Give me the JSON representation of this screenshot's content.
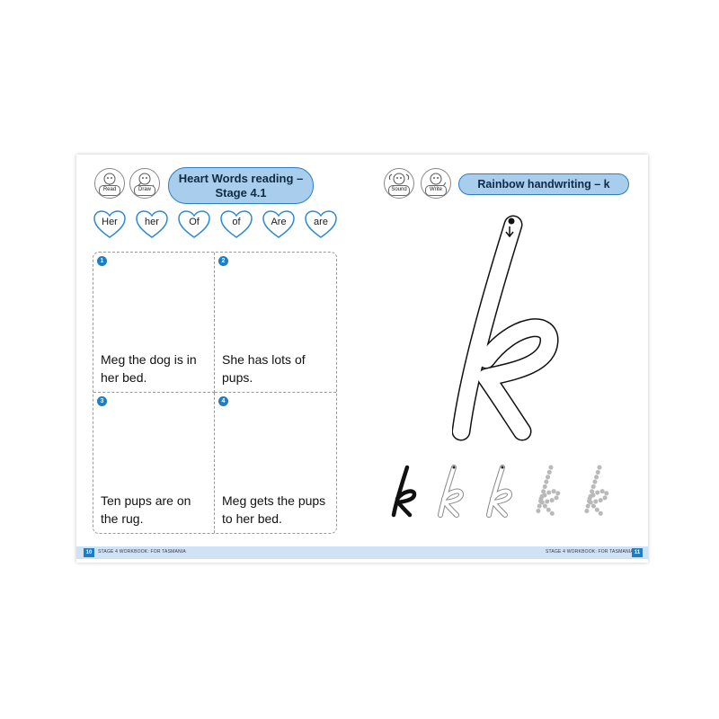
{
  "left_page": {
    "badges": [
      {
        "label": "Read"
      },
      {
        "label": "Draw"
      }
    ],
    "title_line1": "Heart Words reading –",
    "title_line2": "Stage 4.1",
    "heart_words": [
      "Her",
      "her",
      "Of",
      "of",
      "Are",
      "are"
    ],
    "panels": [
      {
        "number": "1",
        "text": "Meg the dog is in her bed."
      },
      {
        "number": "2",
        "text": "She has lots of pups."
      },
      {
        "number": "3",
        "text": "Ten pups are on the rug."
      },
      {
        "number": "4",
        "text": "Meg gets the pups to her bed."
      }
    ],
    "footer": {
      "page_number": "10",
      "text": "STAGE 4 WORKBOOK: FOR TASMANIA"
    }
  },
  "right_page": {
    "badges": [
      {
        "label": "Sound"
      },
      {
        "label": "Write"
      }
    ],
    "title": "Rainbow handwriting – k",
    "practice_letters": [
      {
        "style": "solid",
        "letter": "k"
      },
      {
        "style": "outline",
        "letter": "k"
      },
      {
        "style": "outline",
        "letter": "k"
      },
      {
        "style": "dotted",
        "letter": "k"
      },
      {
        "style": "dotted",
        "letter": "k"
      }
    ],
    "footer": {
      "page_number": "11",
      "text": "STAGE 4 WORKBOOK: FOR TASMANIA"
    }
  },
  "colors": {
    "accent": "#1f7ec1",
    "pill_fill": "#a9cdec",
    "footer_band": "#cfe3f4",
    "heart_stroke": "#2a8ad0"
  }
}
